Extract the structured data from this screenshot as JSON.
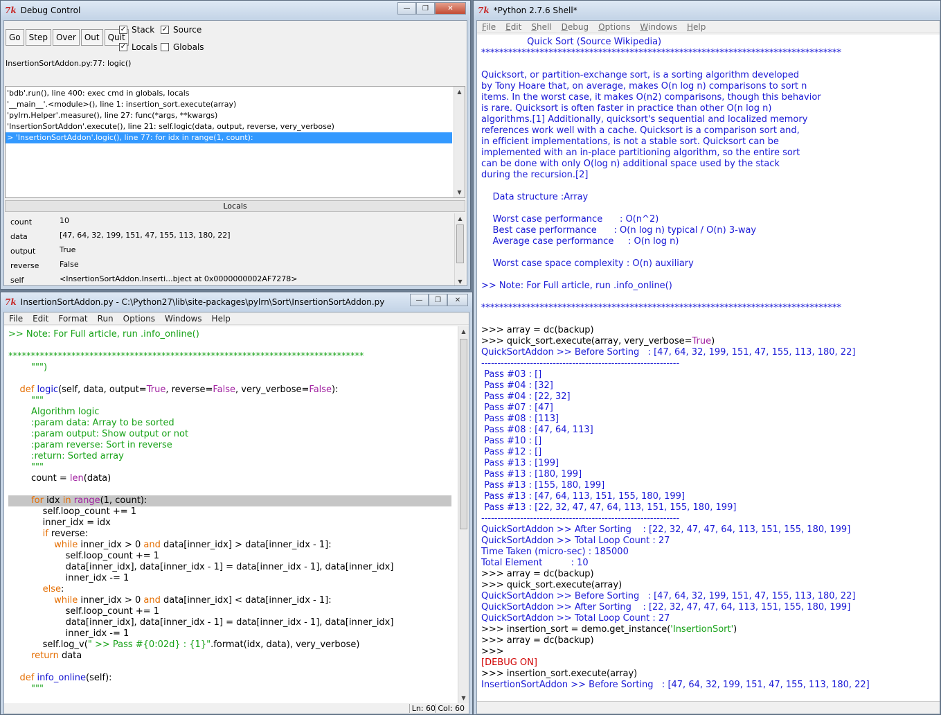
{
  "debug": {
    "title": "Debug Control",
    "buttons": [
      "Go",
      "Step",
      "Over",
      "Out",
      "Quit"
    ],
    "checkboxes": [
      {
        "label": "Stack",
        "checked": true
      },
      {
        "label": "Source",
        "checked": true
      },
      {
        "label": "Locals",
        "checked": true
      },
      {
        "label": "Globals",
        "checked": false
      }
    ],
    "status": "InsertionSortAddon.py:77: logic()",
    "stack": [
      "'bdb'.run(), line 400: exec cmd in globals, locals",
      "'__main__'.<module>(), line 1: insertion_sort.execute(array)",
      "'pylrn.Helper'.measure(), line 27: func(*args, **kwargs)",
      "'InsertionSortAddon'.execute(), line 21: self.logic(data, output, reverse, very_verbose)",
      "> 'InsertionSortAddon'.logic(), line 77: for idx in range(1, count):"
    ],
    "locals_header": "Locals",
    "locals": [
      {
        "name": "count",
        "value": "10"
      },
      {
        "name": "data",
        "value": "[47, 64, 32, 199, 151, 47, 155, 113, 180, 22]"
      },
      {
        "name": "output",
        "value": "True"
      },
      {
        "name": "reverse",
        "value": "False"
      },
      {
        "name": "self",
        "value": "<InsertionSortAddon.Inserti...bject at 0x0000000002AF7278>"
      }
    ]
  },
  "editor": {
    "title": "InsertionSortAddon.py - C:\\Python27\\lib\\site-packages\\pylrn\\Sort\\InsertionSortAddon.py",
    "menu": [
      "File",
      "Edit",
      "Format",
      "Run",
      "Options",
      "Windows",
      "Help"
    ],
    "status_ln": "Ln: 60",
    "status_col": "Col: 60"
  },
  "shell": {
    "title": "*Python 2.7.6 Shell*",
    "menu": [
      "File",
      "Edit",
      "Shell",
      "Debug",
      "Options",
      "Windows",
      "Help"
    ]
  },
  "colors": {
    "keyword": "#e46d00",
    "string": "#18a218",
    "output": "#1a1ad6",
    "builtin": "#a020a0",
    "error": "#d00000"
  }
}
